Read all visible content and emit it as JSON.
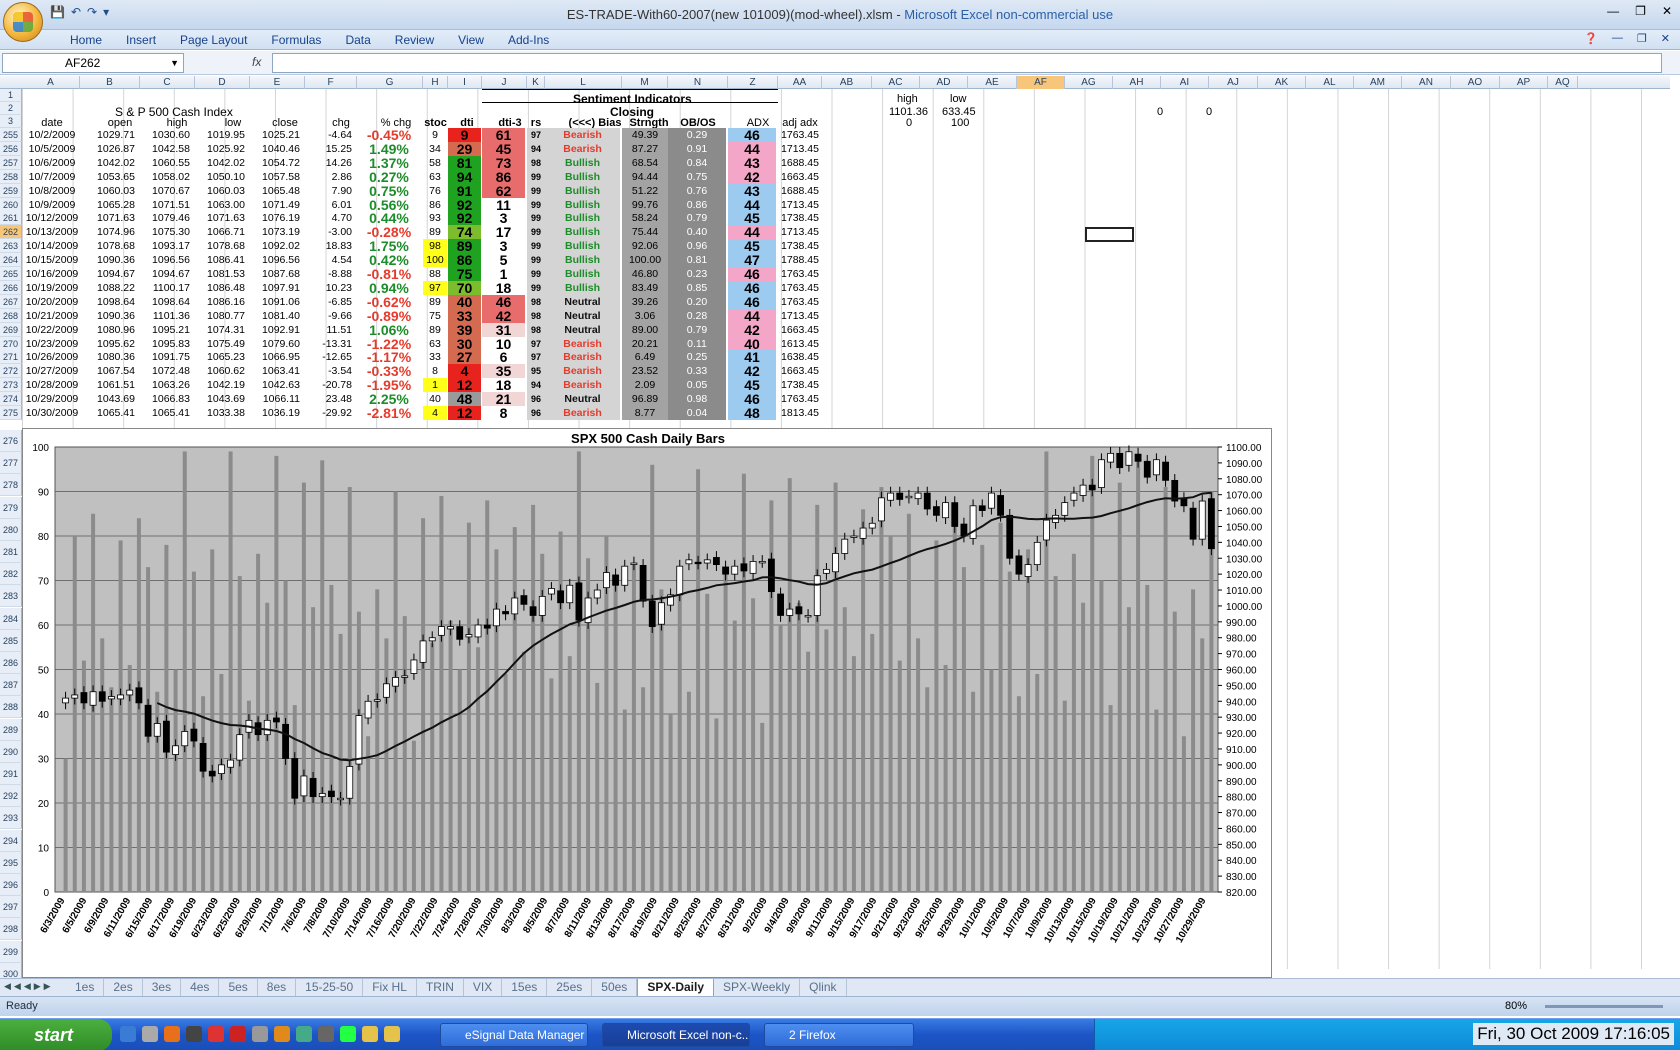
{
  "window": {
    "title": "ES-TRADE-With60-2007(new 101009)(mod-wheel).xlsm",
    "app": "Microsoft Excel non-commercial use"
  },
  "ribbon_tabs": [
    "Home",
    "Insert",
    "Page Layout",
    "Formulas",
    "Data",
    "Review",
    "View",
    "Add-Ins"
  ],
  "namebox": "AF262",
  "fx": "fx",
  "columns": [
    "A",
    "B",
    "C",
    "D",
    "E",
    "F",
    "G",
    "H",
    "I",
    "J",
    "K",
    "L",
    "M",
    "N",
    "Z",
    "AA",
    "AB",
    "AC",
    "AD",
    "AE",
    "AF",
    "AG",
    "AH",
    "AI",
    "AJ",
    "AK",
    "AL",
    "AM",
    "AN",
    "AO",
    "AP",
    "AQ"
  ],
  "header": {
    "sentiment": "Sentiment Indicators",
    "closing": "Closing",
    "sp500": "S & P 500 Cash Index",
    "high_lbl": "high",
    "high_val": "1101.36",
    "high_zero": "0",
    "low_lbl": "low",
    "low_val": "633.45",
    "low_hundred": "100",
    "ag": "0",
    "ah": "0",
    "cols": [
      "date",
      "open",
      "high",
      "low",
      "close",
      "chg",
      "% chg",
      "stoc",
      "dti",
      "dti-3",
      "rs",
      "(<<<) Bias",
      "Strngth",
      "OB/OS",
      "ADX",
      "adj adx"
    ]
  },
  "rows": [
    {
      "n": "255",
      "d": [
        "10/2/2009",
        "1029.71",
        "1030.60",
        "1019.95",
        "1025.21",
        "-4.64",
        "-0.45%",
        "9",
        "9",
        "61",
        "97",
        "Bearish",
        "49.39",
        "0.29",
        "46",
        "1763.45"
      ]
    },
    {
      "n": "256",
      "d": [
        "10/5/2009",
        "1026.87",
        "1042.58",
        "1025.92",
        "1040.46",
        "15.25",
        "1.49%",
        "34",
        "29",
        "45",
        "94",
        "Bearish",
        "87.27",
        "0.91",
        "44",
        "1713.45"
      ]
    },
    {
      "n": "257",
      "d": [
        "10/6/2009",
        "1042.02",
        "1060.55",
        "1042.02",
        "1054.72",
        "14.26",
        "1.37%",
        "58",
        "81",
        "73",
        "98",
        "Bullish",
        "68.54",
        "0.84",
        "43",
        "1688.45"
      ]
    },
    {
      "n": "258",
      "d": [
        "10/7/2009",
        "1053.65",
        "1058.02",
        "1050.10",
        "1057.58",
        "2.86",
        "0.27%",
        "63",
        "94",
        "86",
        "99",
        "Bullish",
        "94.44",
        "0.75",
        "42",
        "1663.45"
      ]
    },
    {
      "n": "259",
      "d": [
        "10/8/2009",
        "1060.03",
        "1070.67",
        "1060.03",
        "1065.48",
        "7.90",
        "0.75%",
        "76",
        "91",
        "62",
        "99",
        "Bullish",
        "51.22",
        "0.76",
        "43",
        "1688.45"
      ]
    },
    {
      "n": "260",
      "d": [
        "10/9/2009",
        "1065.28",
        "1071.51",
        "1063.00",
        "1071.49",
        "6.01",
        "0.56%",
        "86",
        "92",
        "11",
        "99",
        "Bullish",
        "99.76",
        "0.86",
        "44",
        "1713.45"
      ]
    },
    {
      "n": "261",
      "d": [
        "10/12/2009",
        "1071.63",
        "1079.46",
        "1071.63",
        "1076.19",
        "4.70",
        "0.44%",
        "93",
        "92",
        "3",
        "99",
        "Bullish",
        "58.24",
        "0.79",
        "45",
        "1738.45"
      ]
    },
    {
      "n": "262",
      "d": [
        "10/13/2009",
        "1074.96",
        "1075.30",
        "1066.71",
        "1073.19",
        "-3.00",
        "-0.28%",
        "89",
        "74",
        "17",
        "99",
        "Bullish",
        "75.44",
        "0.40",
        "44",
        "1713.45"
      ]
    },
    {
      "n": "263",
      "d": [
        "10/14/2009",
        "1078.68",
        "1093.17",
        "1078.68",
        "1092.02",
        "18.83",
        "1.75%",
        "98",
        "89",
        "3",
        "99",
        "Bullish",
        "92.06",
        "0.96",
        "45",
        "1738.45"
      ]
    },
    {
      "n": "264",
      "d": [
        "10/15/2009",
        "1090.36",
        "1096.56",
        "1086.41",
        "1096.56",
        "4.54",
        "0.42%",
        "100",
        "86",
        "5",
        "99",
        "Bullish",
        "100.00",
        "0.81",
        "47",
        "1788.45"
      ]
    },
    {
      "n": "265",
      "d": [
        "10/16/2009",
        "1094.67",
        "1094.67",
        "1081.53",
        "1087.68",
        "-8.88",
        "-0.81%",
        "88",
        "75",
        "1",
        "99",
        "Bullish",
        "46.80",
        "0.23",
        "46",
        "1763.45"
      ]
    },
    {
      "n": "266",
      "d": [
        "10/19/2009",
        "1088.22",
        "1100.17",
        "1086.48",
        "1097.91",
        "10.23",
        "0.94%",
        "97",
        "70",
        "18",
        "99",
        "Bullish",
        "83.49",
        "0.85",
        "46",
        "1763.45"
      ]
    },
    {
      "n": "267",
      "d": [
        "10/20/2009",
        "1098.64",
        "1098.64",
        "1086.16",
        "1091.06",
        "-6.85",
        "-0.62%",
        "89",
        "40",
        "46",
        "98",
        "Neutral",
        "39.26",
        "0.20",
        "46",
        "1763.45"
      ]
    },
    {
      "n": "268",
      "d": [
        "10/21/2009",
        "1090.36",
        "1101.36",
        "1080.77",
        "1081.40",
        "-9.66",
        "-0.89%",
        "75",
        "33",
        "42",
        "98",
        "Neutral",
        "3.06",
        "0.28",
        "44",
        "1713.45"
      ]
    },
    {
      "n": "269",
      "d": [
        "10/22/2009",
        "1080.96",
        "1095.21",
        "1074.31",
        "1092.91",
        "11.51",
        "1.06%",
        "89",
        "39",
        "31",
        "98",
        "Neutral",
        "89.00",
        "0.79",
        "42",
        "1663.45"
      ]
    },
    {
      "n": "270",
      "d": [
        "10/23/2009",
        "1095.62",
        "1095.83",
        "1075.49",
        "1079.60",
        "-13.31",
        "-1.22%",
        "63",
        "30",
        "10",
        "97",
        "Bearish",
        "20.21",
        "0.11",
        "40",
        "1613.45"
      ]
    },
    {
      "n": "271",
      "d": [
        "10/26/2009",
        "1080.36",
        "1091.75",
        "1065.23",
        "1066.95",
        "-12.65",
        "-1.17%",
        "33",
        "27",
        "6",
        "97",
        "Bearish",
        "6.49",
        "0.25",
        "41",
        "1638.45"
      ]
    },
    {
      "n": "272",
      "d": [
        "10/27/2009",
        "1067.54",
        "1072.48",
        "1060.62",
        "1063.41",
        "-3.54",
        "-0.33%",
        "8",
        "4",
        "35",
        "95",
        "Bearish",
        "23.52",
        "0.33",
        "42",
        "1663.45"
      ]
    },
    {
      "n": "273",
      "d": [
        "10/28/2009",
        "1061.51",
        "1063.26",
        "1042.19",
        "1042.63",
        "-20.78",
        "-1.95%",
        "1",
        "12",
        "18",
        "94",
        "Bearish",
        "2.09",
        "0.05",
        "45",
        "1738.45"
      ]
    },
    {
      "n": "274",
      "d": [
        "10/29/2009",
        "1043.69",
        "1066.83",
        "1043.69",
        "1066.11",
        "23.48",
        "2.25%",
        "40",
        "48",
        "21",
        "96",
        "Neutral",
        "96.89",
        "0.98",
        "46",
        "1763.45"
      ]
    },
    {
      "n": "275",
      "d": [
        "10/30/2009",
        "1065.41",
        "1065.41",
        "1033.38",
        "1036.19",
        "-29.92",
        "-2.81%",
        "4",
        "12",
        "8",
        "96",
        "Bearish",
        "8.77",
        "0.04",
        "48",
        "1813.45"
      ]
    }
  ],
  "lower_rows": [
    "276",
    "277",
    "278",
    "279",
    "280",
    "281",
    "282",
    "283",
    "284",
    "285",
    "286",
    "287",
    "288",
    "289",
    "290",
    "291",
    "292",
    "293",
    "294",
    "295",
    "296",
    "297",
    "298",
    "299",
    "300"
  ],
  "chart_data": {
    "type": "candlestick",
    "title": "SPX 500 Cash Daily Bars",
    "y_left_ticks": [
      "0",
      "10",
      "20",
      "30",
      "40",
      "50",
      "60",
      "70",
      "80",
      "90",
      "100"
    ],
    "y_right_ticks": [
      "820.00",
      "830.00",
      "840.00",
      "850.00",
      "860.00",
      "870.00",
      "880.00",
      "890.00",
      "900.00",
      "910.00",
      "920.00",
      "930.00",
      "940.00",
      "950.00",
      "960.00",
      "970.00",
      "980.00",
      "990.00",
      "1000.00",
      "1010.00",
      "1020.00",
      "1030.00",
      "1040.00",
      "1050.00",
      "1060.00",
      "1070.00",
      "1080.00",
      "1090.00",
      "1100.00"
    ],
    "x_labels": [
      "6/3/2009",
      "6/5/2009",
      "6/9/2009",
      "6/11/2009",
      "6/15/2009",
      "6/17/2009",
      "6/19/2009",
      "6/23/2009",
      "6/25/2009",
      "6/29/2009",
      "7/1/2009",
      "7/6/2009",
      "7/8/2009",
      "7/10/2009",
      "7/14/2009",
      "7/16/2009",
      "7/20/2009",
      "7/22/2009",
      "7/24/2009",
      "7/28/2009",
      "7/30/2009",
      "8/3/2009",
      "8/5/2009",
      "8/7/2009",
      "8/11/2009",
      "8/13/2009",
      "8/17/2009",
      "8/19/2009",
      "8/21/2009",
      "8/25/2009",
      "8/27/2009",
      "8/31/2009",
      "9/2/2009",
      "9/4/2009",
      "9/9/2009",
      "9/11/2009",
      "9/15/2009",
      "9/17/2009",
      "9/21/2009",
      "9/23/2009",
      "9/25/2009",
      "9/29/2009",
      "10/1/2009",
      "10/5/2009",
      "10/7/2009",
      "10/9/2009",
      "10/13/2009",
      "10/15/2009",
      "10/19/2009",
      "10/21/2009",
      "10/23/2009",
      "10/27/2009",
      "10/29/2009"
    ],
    "closes": [
      942,
      944,
      939,
      946,
      940,
      943,
      944,
      947,
      939,
      918,
      926,
      908,
      912,
      921,
      915,
      896,
      893,
      900,
      903,
      919,
      928,
      919,
      928,
      927,
      904,
      879,
      893,
      880,
      882,
      880,
      879,
      899,
      931,
      940,
      941,
      951,
      955,
      956,
      966,
      978,
      980,
      987,
      987,
      979,
      982,
      988,
      986,
      998,
      995,
      1005,
      1001,
      994,
      1006,
      1011,
      1002,
      1013,
      991,
      1005,
      1010,
      1021,
      1013,
      1025,
      1027,
      1003,
      987,
      1002,
      1007,
      1025,
      1029,
      1027,
      1029,
      1026,
      1020,
      1025,
      1022,
      1028,
      1028,
      1009,
      994,
      998,
      995,
      994,
      1019,
      1023,
      1033,
      1042,
      1044,
      1049,
      1052,
      1068,
      1071,
      1067,
      1069,
      1071,
      1061,
      1057,
      1065,
      1050,
      1044,
      1063,
      1060,
      1071,
      1057,
      1030,
      1020,
      1026,
      1040,
      1054,
      1057,
      1065,
      1071,
      1076,
      1073,
      1092,
      1096,
      1087,
      1097,
      1091,
      1081,
      1092,
      1079,
      1066,
      1063,
      1042,
      1066,
      1036
    ],
    "ma": "moving average line (dark)",
    "volume_bars": "grey vertical bars on left 0-100 axis",
    "ylim_right": [
      820,
      1100
    ],
    "ylim_left": [
      0,
      100
    ],
    "grid": true
  },
  "sheet_tabs": [
    "1es",
    "2es",
    "3es",
    "4es",
    "5es",
    "8es",
    "15-25-50",
    "Fix HL",
    "TRIN",
    "VIX",
    "15es",
    "25es",
    "50es",
    "SPX-Daily",
    "SPX-Weekly",
    "Qlink"
  ],
  "active_sheet": "SPX-Daily",
  "status": {
    "ready": "Ready",
    "zoom": "80%"
  },
  "taskbar": {
    "start": "start",
    "items": [
      "eSignal Data Manager",
      "Microsoft Excel non-c...",
      "2 Firefox"
    ],
    "clock": "Fri, 30 Oct 2009  17:16:05"
  },
  "colors": {
    "bearish": "#e53b2c",
    "bullish": "#1d8c2a",
    "green_cell": "#1fa21f",
    "red_cell": "#e8231d",
    "yellow": "#ffff1a",
    "pink": "#f4a6c8",
    "adx_blue": "#9dcbf0",
    "gray": "#8b8b8b"
  }
}
